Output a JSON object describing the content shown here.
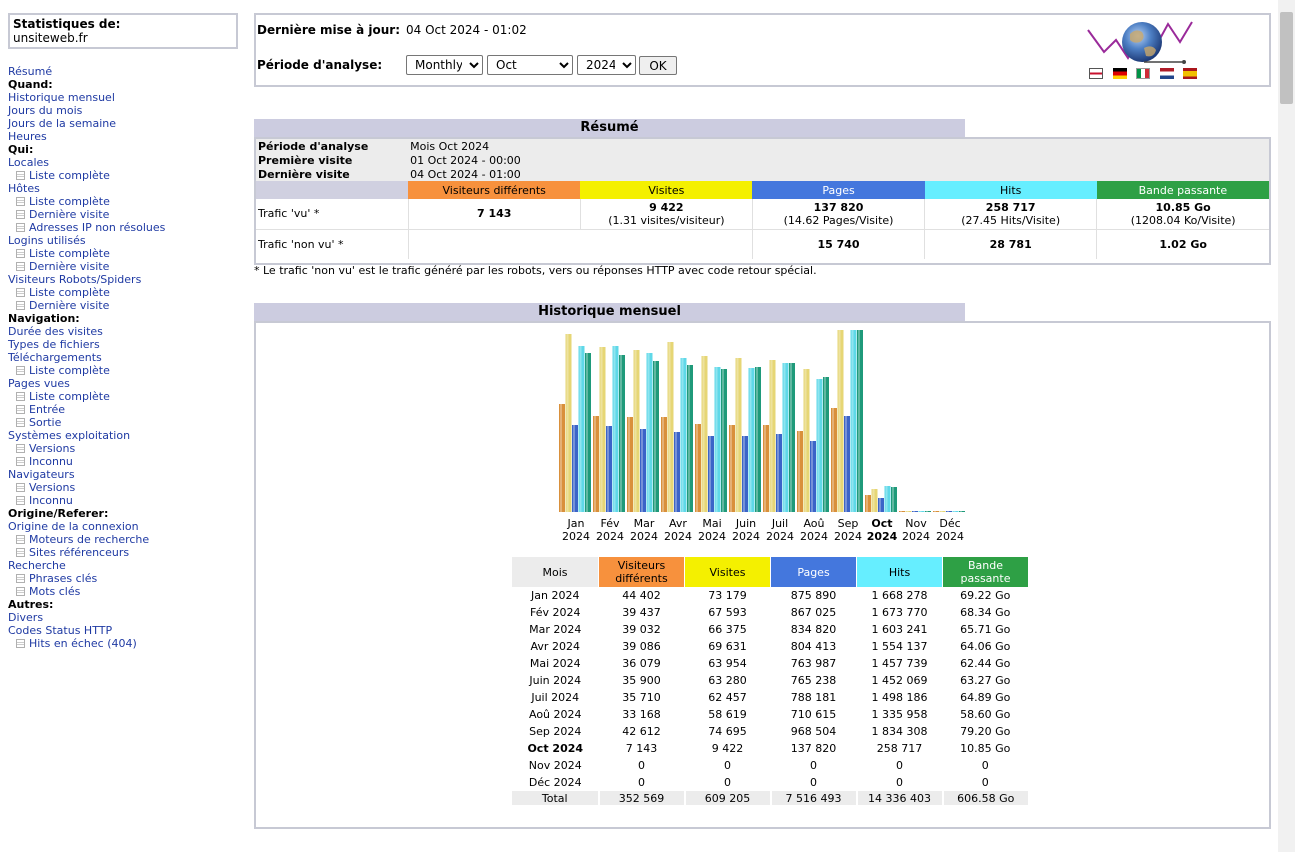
{
  "site": {
    "title": "Statistiques de:",
    "name": "unsiteweb.fr"
  },
  "menu": [
    {
      "label": "Résumé",
      "type": "link"
    },
    {
      "label": "Quand:",
      "type": "head"
    },
    {
      "label": "Historique mensuel",
      "type": "link"
    },
    {
      "label": "Jours du mois",
      "type": "link"
    },
    {
      "label": "Jours de la semaine",
      "type": "link"
    },
    {
      "label": "Heures",
      "type": "link"
    },
    {
      "label": "Qui:",
      "type": "head"
    },
    {
      "label": "Locales",
      "type": "link"
    },
    {
      "label": "Liste complète",
      "type": "sub"
    },
    {
      "label": "Hôtes",
      "type": "link"
    },
    {
      "label": "Liste complète",
      "type": "sub"
    },
    {
      "label": "Dernière visite",
      "type": "sub"
    },
    {
      "label": "Adresses IP non résolues",
      "type": "sub"
    },
    {
      "label": "Logins utilisés",
      "type": "link"
    },
    {
      "label": "Liste complète",
      "type": "sub"
    },
    {
      "label": "Dernière visite",
      "type": "sub"
    },
    {
      "label": "Visiteurs Robots/Spiders",
      "type": "link"
    },
    {
      "label": "Liste complète",
      "type": "sub"
    },
    {
      "label": "Dernière visite",
      "type": "sub"
    },
    {
      "label": "Navigation:",
      "type": "head"
    },
    {
      "label": "Durée des visites",
      "type": "link"
    },
    {
      "label": "Types de fichiers",
      "type": "link"
    },
    {
      "label": "Téléchargements",
      "type": "link"
    },
    {
      "label": "Liste complète",
      "type": "sub"
    },
    {
      "label": "Pages vues",
      "type": "link"
    },
    {
      "label": "Liste complète",
      "type": "sub"
    },
    {
      "label": "Entrée",
      "type": "sub"
    },
    {
      "label": "Sortie",
      "type": "sub"
    },
    {
      "label": "Systèmes exploitation",
      "type": "link"
    },
    {
      "label": "Versions",
      "type": "sub"
    },
    {
      "label": "Inconnu",
      "type": "sub"
    },
    {
      "label": "Navigateurs",
      "type": "link"
    },
    {
      "label": "Versions",
      "type": "sub"
    },
    {
      "label": "Inconnu",
      "type": "sub"
    },
    {
      "label": "Origine/Referer:",
      "type": "head"
    },
    {
      "label": "Origine de la connexion",
      "type": "link"
    },
    {
      "label": "Moteurs de recherche",
      "type": "sub"
    },
    {
      "label": "Sites référenceurs",
      "type": "sub"
    },
    {
      "label": "Recherche",
      "type": "link"
    },
    {
      "label": "Phrases clés",
      "type": "sub"
    },
    {
      "label": "Mots clés",
      "type": "sub"
    },
    {
      "label": "Autres:",
      "type": "head"
    },
    {
      "label": "Divers",
      "type": "link"
    },
    {
      "label": "Codes Status HTTP",
      "type": "link"
    },
    {
      "label": "Hits en échec (404)",
      "type": "sub"
    }
  ],
  "header": {
    "updated_label": "Dernière mise à jour:",
    "updated_value": "04 Oct 2024 - 01:02",
    "period_label": "Période d'analyse:",
    "period_type": "Monthly",
    "period_month": "Oct",
    "period_year": "2024",
    "ok_label": "OK"
  },
  "resume": {
    "title": "Résumé",
    "period_label": "Période d'analyse",
    "period_value": "Mois Oct 2024",
    "first_label": "Première visite",
    "first_value": "01 Oct 2024 - 00:00",
    "last_label": "Dernière visite",
    "last_value": "04 Oct 2024 - 01:00",
    "cols": [
      "Visiteurs différents",
      "Visites",
      "Pages",
      "Hits",
      "Bande passante"
    ],
    "seen_label": "Trafic 'vu' *",
    "seen": [
      {
        "v": "7 143",
        "s": ""
      },
      {
        "v": "9 422",
        "s": "(1.31 visites/visiteur)"
      },
      {
        "v": "137 820",
        "s": "(14.62 Pages/Visite)"
      },
      {
        "v": "258 717",
        "s": "(27.45 Hits/Visite)"
      },
      {
        "v": "10.85 Go",
        "s": "(1208.04 Ko/Visite)"
      }
    ],
    "unseen_label": "Trafic 'non vu' *",
    "unseen": [
      "15 740",
      "28 781",
      "1.02 Go"
    ],
    "note": "* Le trafic 'non vu' est le trafic généré par les robots, vers ou réponses HTTP avec code retour spécial."
  },
  "history": {
    "title": "Historique mensuel",
    "cols": [
      "Mois",
      "Visiteurs différents",
      "Visites",
      "Pages",
      "Hits",
      "Bande passante"
    ],
    "total_label": "Total",
    "total": [
      "352 569",
      "609 205",
      "7 516 493",
      "14 336 403",
      "606.58 Go"
    ]
  },
  "chart_data": {
    "type": "bar",
    "categories": [
      "Jan 2024",
      "Fév 2024",
      "Mar 2024",
      "Avr 2024",
      "Mai 2024",
      "Juin 2024",
      "Juil 2024",
      "Aoû 2024",
      "Sep 2024",
      "Oct 2024",
      "Nov 2024",
      "Déc 2024"
    ],
    "month_labels": [
      [
        "Jan",
        "2024"
      ],
      [
        "Fév",
        "2024"
      ],
      [
        "Mar",
        "2024"
      ],
      [
        "Avr",
        "2024"
      ],
      [
        "Mai",
        "2024"
      ],
      [
        "Juin",
        "2024"
      ],
      [
        "Juil",
        "2024"
      ],
      [
        "Aoû",
        "2024"
      ],
      [
        "Sep",
        "2024"
      ],
      [
        "Oct",
        "2024"
      ],
      [
        "Nov",
        "2024"
      ],
      [
        "Déc",
        "2024"
      ]
    ],
    "current_index": 9,
    "series": [
      {
        "name": "Visiteurs différents",
        "color": "#f7913d",
        "values": [
          44402,
          39437,
          39032,
          39086,
          36079,
          35900,
          35710,
          33168,
          42612,
          7143,
          0,
          0
        ],
        "display": [
          "44 402",
          "39 437",
          "39 032",
          "39 086",
          "36 079",
          "35 900",
          "35 710",
          "33 168",
          "42 612",
          "7 143",
          "0",
          "0"
        ]
      },
      {
        "name": "Visites",
        "color": "#f4f000",
        "values": [
          73179,
          67593,
          66375,
          69631,
          63954,
          63280,
          62457,
          58619,
          74695,
          9422,
          0,
          0
        ],
        "display": [
          "73 179",
          "67 593",
          "66 375",
          "69 631",
          "63 954",
          "63 280",
          "62 457",
          "58 619",
          "74 695",
          "9 422",
          "0",
          "0"
        ]
      },
      {
        "name": "Pages",
        "color": "#4477dd",
        "values": [
          875890,
          867025,
          834820,
          804413,
          763987,
          765238,
          788181,
          710615,
          968504,
          137820,
          0,
          0
        ],
        "display": [
          "875 890",
          "867 025",
          "834 820",
          "804 413",
          "763 987",
          "765 238",
          "788 181",
          "710 615",
          "968 504",
          "137 820",
          "0",
          "0"
        ]
      },
      {
        "name": "Hits",
        "color": "#66eeff",
        "values": [
          1668278,
          1673770,
          1603241,
          1554137,
          1457739,
          1452069,
          1498186,
          1335958,
          1834308,
          258717,
          0,
          0
        ],
        "display": [
          "1 668 278",
          "1 673 770",
          "1 603 241",
          "1 554 137",
          "1 457 739",
          "1 452 069",
          "1 498 186",
          "1 335 958",
          "1 834 308",
          "258 717",
          "0",
          "0"
        ]
      },
      {
        "name": "Bande passante",
        "color": "#2ea045",
        "values": [
          69.22,
          68.34,
          65.71,
          64.06,
          62.44,
          63.27,
          64.89,
          58.6,
          79.2,
          10.85,
          0,
          0
        ],
        "display": [
          "69.22 Go",
          "68.34 Go",
          "65.71 Go",
          "64.06 Go",
          "62.44 Go",
          "63.27 Go",
          "64.89 Go",
          "58.60 Go",
          "79.20 Go",
          "10.85 Go",
          "0",
          "0"
        ]
      }
    ]
  }
}
